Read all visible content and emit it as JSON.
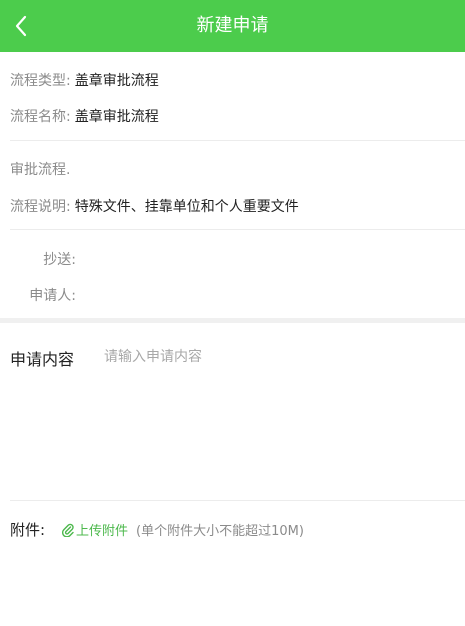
{
  "header": {
    "title": "新建申请",
    "back_icon": "chevron-left-icon"
  },
  "colors": {
    "brand": "#4ccc4c",
    "link": "#4cb84c"
  },
  "info": {
    "process_type_label": "流程类型:",
    "process_type_value": "盖章审批流程",
    "process_name_label": "流程名称:",
    "process_name_value": "盖章审批流程",
    "approval_flow_label": "审批流程.",
    "process_desc_label": "流程说明:",
    "process_desc_value": "特殊文件、挂靠单位和个人重要文件",
    "cc_label": "抄送:",
    "applicant_label": "申请人:"
  },
  "content": {
    "label": "申请内容",
    "placeholder": "请输入申请内容",
    "value": ""
  },
  "attachment": {
    "label": "附件:",
    "upload_label": "上传附件",
    "note": "(单个附件大小不能超过10M)",
    "upload_icon": "paperclip-icon"
  }
}
